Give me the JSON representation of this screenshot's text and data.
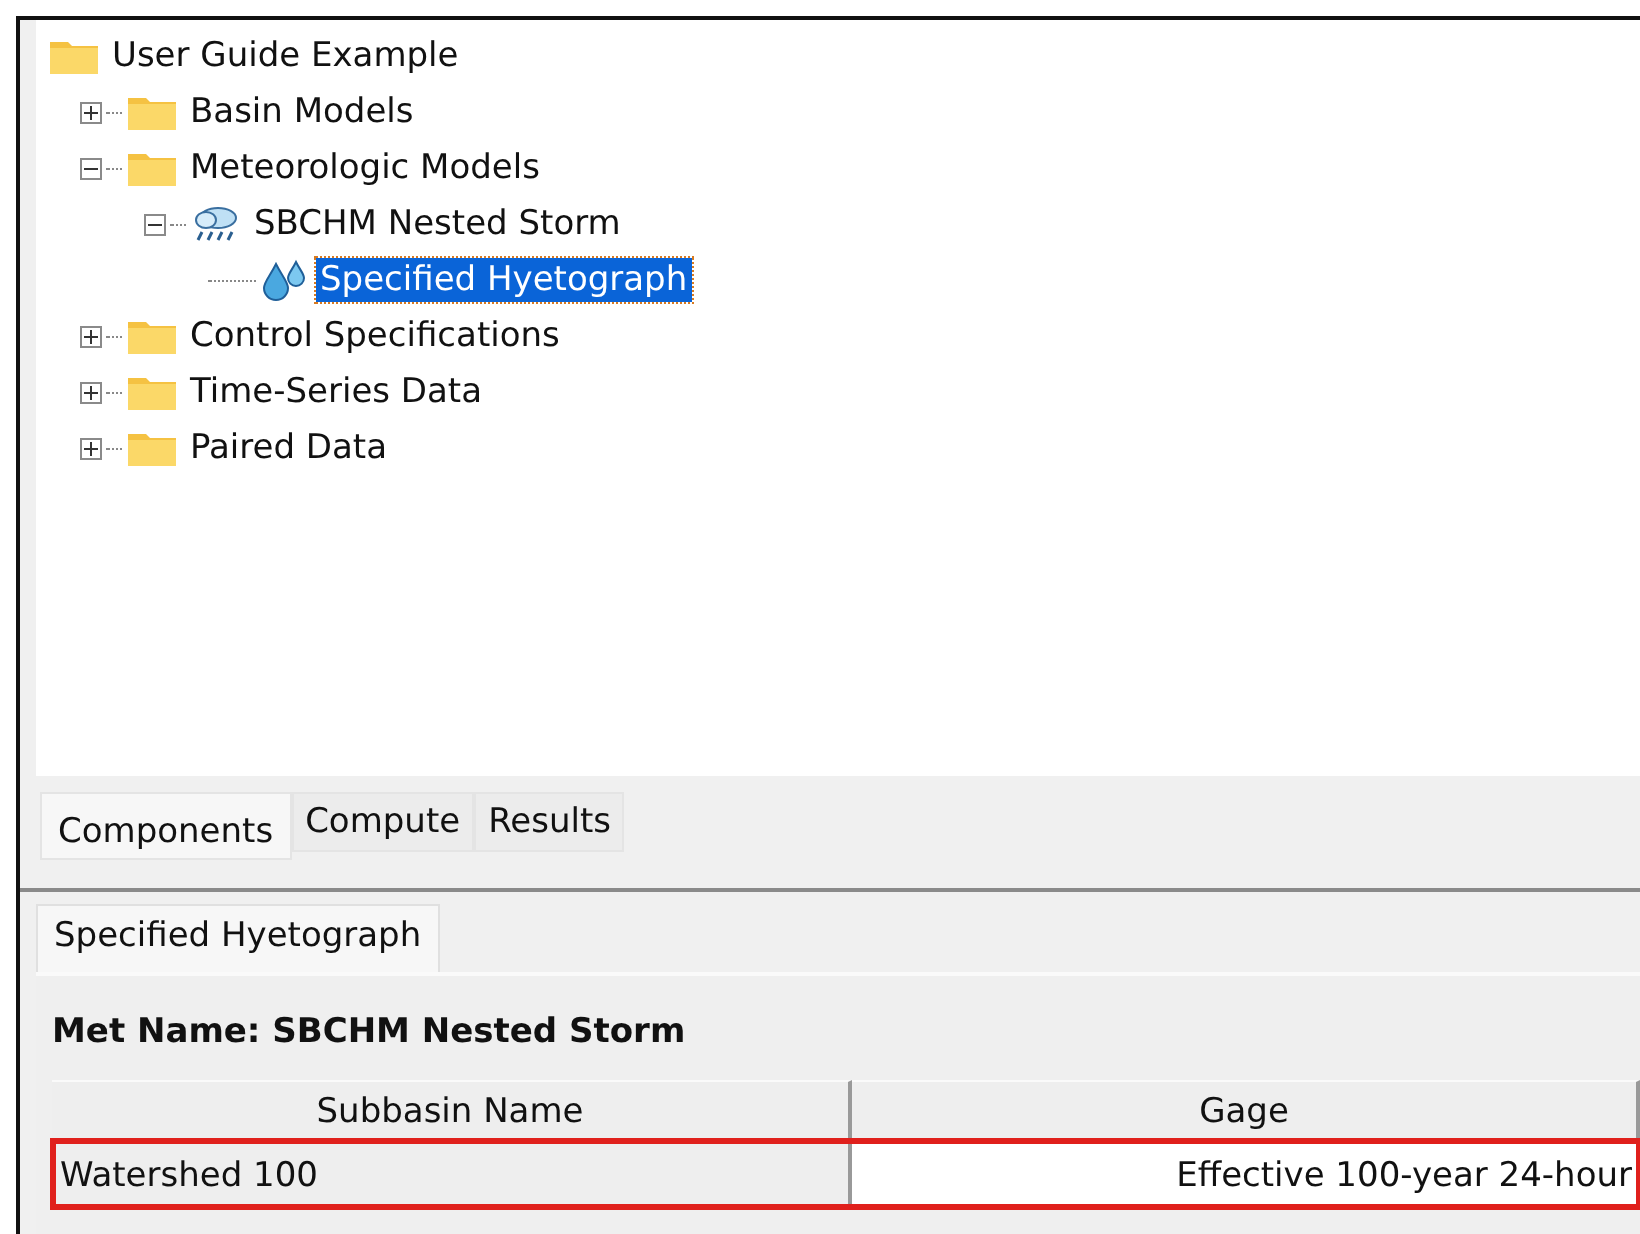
{
  "tree": {
    "label": "User Guide Example",
    "kind": "folder",
    "children": [
      {
        "label": "Basin Models",
        "kind": "folder",
        "expanded": false,
        "selected": false
      },
      {
        "label": "Meteorologic Models",
        "kind": "folder",
        "expanded": true,
        "selected": false,
        "children": [
          {
            "label": "SBCHM Nested Storm",
            "kind": "storm",
            "expanded": true,
            "selected": false,
            "children": [
              {
                "label": "Specified Hyetograph",
                "kind": "drops",
                "selected": true
              }
            ]
          }
        ]
      },
      {
        "label": "Control Specifications",
        "kind": "folder",
        "expanded": false,
        "selected": false
      },
      {
        "label": "Time-Series Data",
        "kind": "folder",
        "expanded": false,
        "selected": false
      },
      {
        "label": "Paired Data",
        "kind": "folder",
        "expanded": false,
        "selected": false
      }
    ]
  },
  "tabs": [
    {
      "label": "Components",
      "selected": true
    },
    {
      "label": "Compute",
      "selected": false
    },
    {
      "label": "Results",
      "selected": false
    }
  ],
  "editor": {
    "tab": "Specified Hyetograph",
    "met_name": "Met Name: SBCHM Nested Storm",
    "columns": [
      "Subbasin Name",
      "Gage"
    ],
    "rows": [
      {
        "cells": [
          "Watershed 100",
          "Effective 100-year 24-hour"
        ],
        "highlighted": true
      }
    ]
  }
}
